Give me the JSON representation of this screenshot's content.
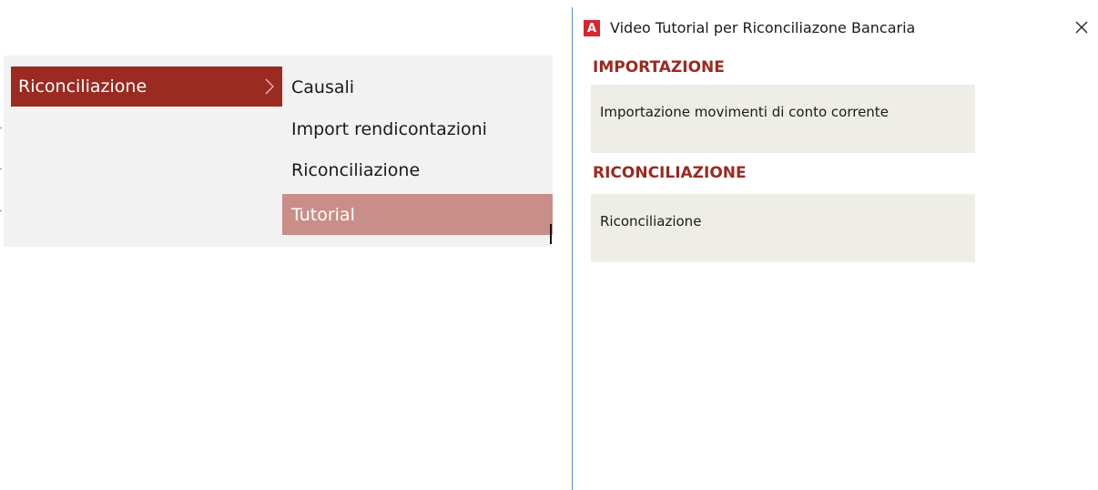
{
  "menu": {
    "main_item": {
      "label": "Riconciliazione"
    },
    "submenu": [
      {
        "label": "Causali",
        "selected": false
      },
      {
        "label": "Import rendicontazioni",
        "selected": false
      },
      {
        "label": "Riconciliazione",
        "selected": false
      },
      {
        "label": "Tutorial",
        "selected": true
      }
    ]
  },
  "dialog": {
    "app_icon_letter": "A",
    "title": "Video Tutorial per Riconciliazone Bancaria",
    "sections": [
      {
        "title": "IMPORTAZIONE",
        "items": [
          "Importazione movimenti di conto corrente"
        ]
      },
      {
        "title": "RICONCILIAZIONE",
        "items": [
          "Riconciliazione"
        ]
      }
    ]
  },
  "colors": {
    "accent": "#9b2a20",
    "selected_item": "#c98e88",
    "card_bg": "#eeeee6",
    "icon_red": "#d9262d",
    "window_border": "#4a90d9"
  }
}
